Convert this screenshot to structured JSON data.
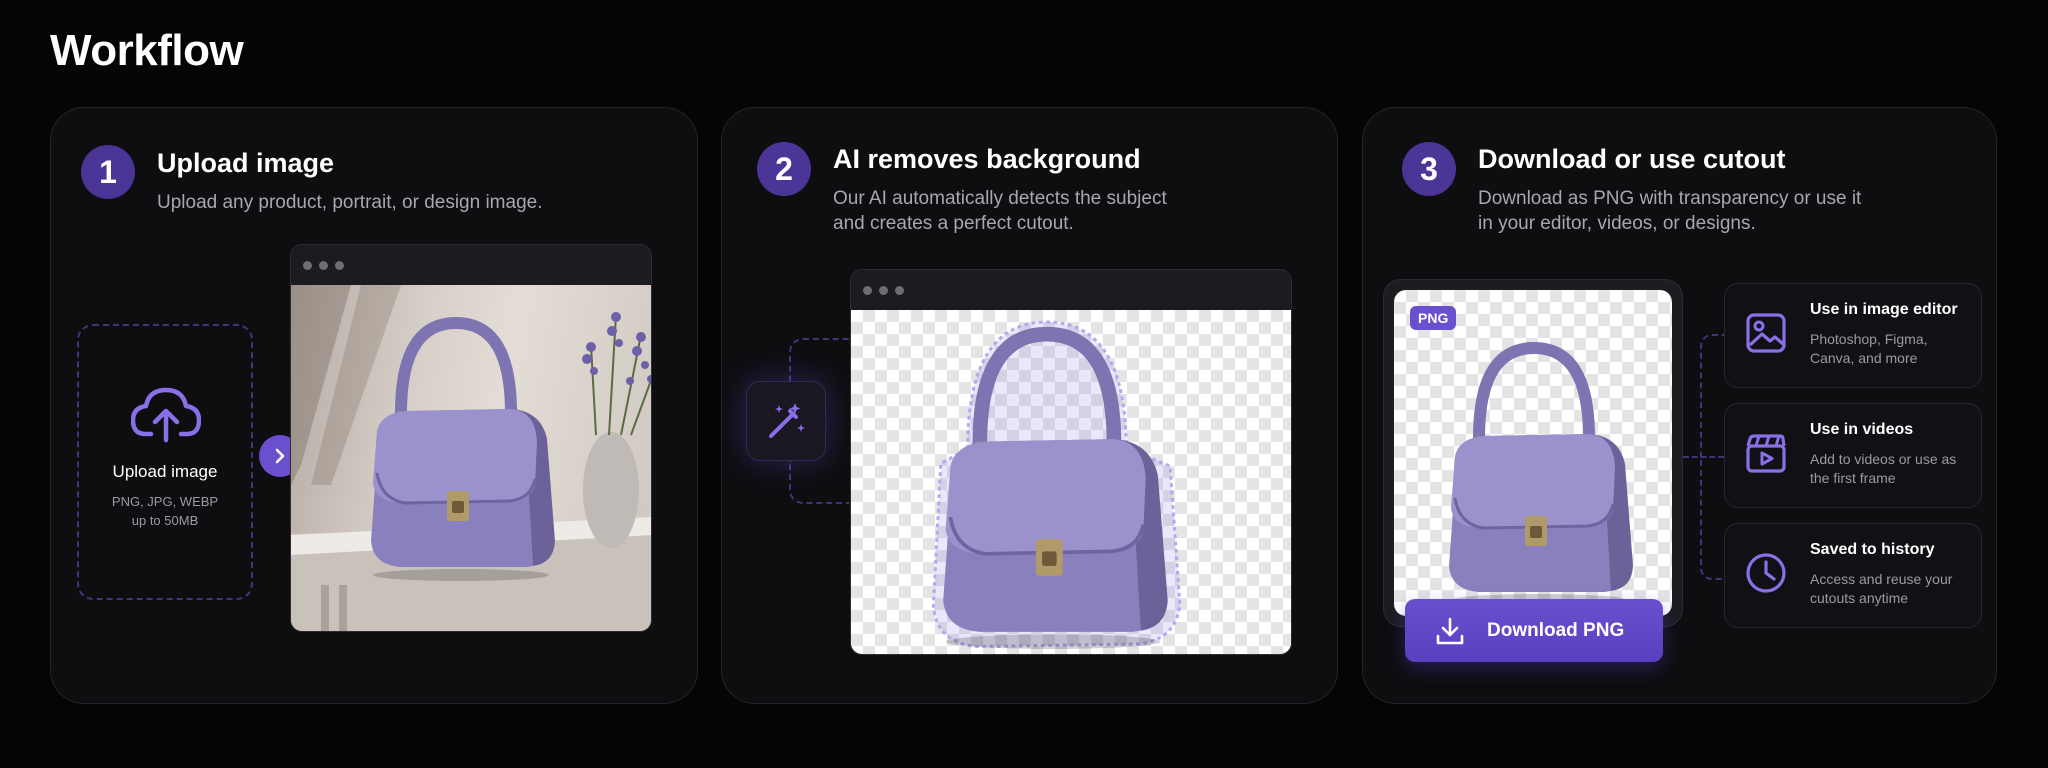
{
  "page": {
    "title": "Workflow"
  },
  "colors": {
    "accent": "#6a4fcf",
    "step_badge": "#4b3596",
    "card_bg": "#0e0e11"
  },
  "steps": [
    {
      "number": "1",
      "title": "Upload image",
      "description": "Upload any product, portrait, or design image.",
      "dropzone": {
        "icon": "cloud-upload-icon",
        "label": "Upload image",
        "hint_line1": "PNG, JPG, WEBP",
        "hint_line2": "up to 50MB"
      },
      "next_icon": "chevron-right-icon"
    },
    {
      "number": "2",
      "title": "AI removes background",
      "description_line1": "Our AI automatically detects the subject",
      "description_line2": "and creates a perfect cutout.",
      "tool_icon": "magic-wand-icon"
    },
    {
      "number": "3",
      "title": "Download or use cutout",
      "description_line1": "Download as PNG with transparency or use it",
      "description_line2": "in your editor, videos, or designs.",
      "badge": "PNG",
      "download_label": "Download PNG",
      "features": [
        {
          "icon": "image-icon",
          "title": "Use in image editor",
          "desc_line1": "Photoshop, Figma,",
          "desc_line2": "Canva, and more"
        },
        {
          "icon": "video-clapper-icon",
          "title": "Use in videos",
          "desc_line1": "Add to videos or use as",
          "desc_line2": "the first frame"
        },
        {
          "icon": "clock-icon",
          "title": "Saved to history",
          "desc_line1": "Access and reuse your",
          "desc_line2": "cutouts anytime"
        }
      ]
    }
  ]
}
